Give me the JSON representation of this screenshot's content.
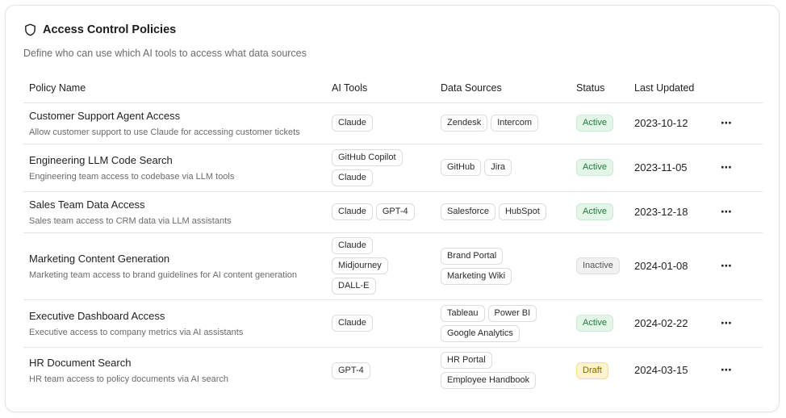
{
  "header": {
    "title": "Access Control Policies",
    "subtitle": "Define who can use which AI tools to access what data sources",
    "icon": "shield-icon"
  },
  "columns": [
    "Policy Name",
    "AI Tools",
    "Data Sources",
    "Status",
    "Last Updated"
  ],
  "rows": [
    {
      "name": "Customer Support Agent Access",
      "description": "Allow customer support to use Claude for accessing customer tickets",
      "tools": [
        "Claude"
      ],
      "sources": [
        "Zendesk",
        "Intercom"
      ],
      "status": "Active",
      "updated": "2023-10-12",
      "more": "⋯"
    },
    {
      "name": "Engineering LLM Code Search",
      "description": "Engineering team access to codebase via LLM tools",
      "tools": [
        "GitHub Copilot",
        "Claude"
      ],
      "sources": [
        "GitHub",
        "Jira"
      ],
      "status": "Active",
      "updated": "2023-11-05",
      "more": "⋯"
    },
    {
      "name": "Sales Team Data Access",
      "description": "Sales team access to CRM data via LLM assistants",
      "tools": [
        "Claude",
        "GPT-4"
      ],
      "sources": [
        "Salesforce",
        "HubSpot"
      ],
      "status": "Active",
      "updated": "2023-12-18",
      "more": "⋯"
    },
    {
      "name": "Marketing Content Generation",
      "description": "Marketing team access to brand guidelines for AI content generation",
      "tools": [
        "Claude",
        "Midjourney",
        "DALL-E"
      ],
      "sources": [
        "Brand Portal",
        "Marketing Wiki"
      ],
      "status": "Inactive",
      "updated": "2024-01-08",
      "more": "⋯"
    },
    {
      "name": "Executive Dashboard Access",
      "description": "Executive access to company metrics via AI assistants",
      "tools": [
        "Claude"
      ],
      "sources": [
        "Tableau",
        "Power BI",
        "Google Analytics"
      ],
      "status": "Active",
      "updated": "2024-02-22",
      "more": "⋯"
    },
    {
      "name": "HR Document Search",
      "description": "HR team access to policy documents via AI search",
      "tools": [
        "GPT-4"
      ],
      "sources": [
        "HR Portal",
        "Employee Handbook"
      ],
      "status": "Draft",
      "updated": "2024-03-15",
      "more": "⋯"
    }
  ],
  "colors": {
    "active_bg": "#e3f6e8",
    "active_text": "#1f7a3a",
    "inactive_bg": "#f1f1f1",
    "draft_bg": "#fdf3cf",
    "draft_text": "#8a6200"
  }
}
